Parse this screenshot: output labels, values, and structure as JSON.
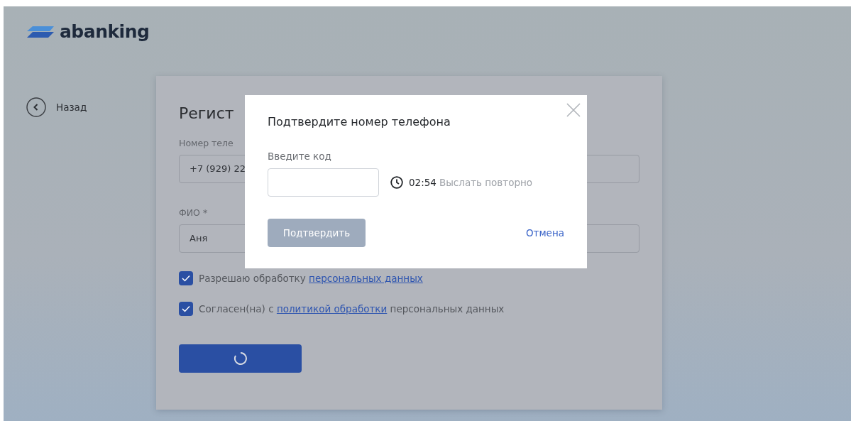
{
  "logo": {
    "text": "abanking"
  },
  "back": {
    "label": "Назад"
  },
  "form": {
    "title": "Регист",
    "fields": [
      {
        "label": "Номер теле",
        "value": "+7 (929) 22"
      },
      {
        "label": "ФИО *",
        "value": "Аня"
      }
    ],
    "consents": [
      {
        "checked": true,
        "text": "Разрешаю обработку ",
        "link": "персональных данных"
      },
      {
        "checked": true,
        "text": "Согласен(на) с ",
        "link": "политикой обработки",
        "after": " персональных данных"
      }
    ],
    "submit": {
      "loading": true
    }
  },
  "modal": {
    "title": "Подтвердите номер телефона",
    "code_label": "Введите код",
    "timer": "02:54",
    "resend": "Выслать повторно",
    "confirm": {
      "label": "Подтвердить",
      "disabled": true
    },
    "cancel": "Отмена"
  }
}
